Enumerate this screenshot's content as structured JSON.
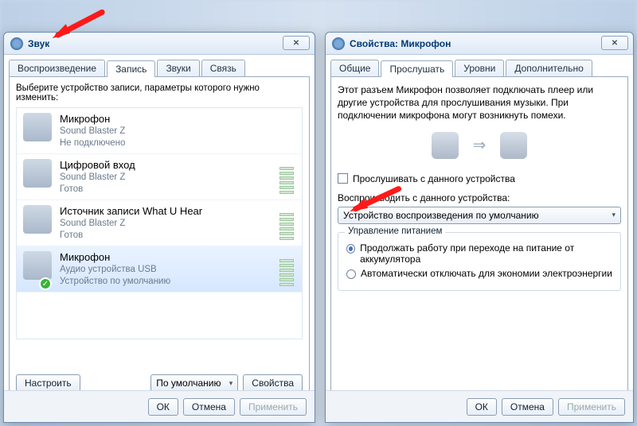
{
  "left": {
    "title": "Звук",
    "tabs": [
      "Воспроизведение",
      "Запись",
      "Звуки",
      "Связь"
    ],
    "active_tab": 1,
    "hint": "Выберите устройство записи, параметры которого нужно изменить:",
    "devices": [
      {
        "name": "Микрофон",
        "sub1": "Sound Blaster Z",
        "sub2": "Не подключено",
        "level": false
      },
      {
        "name": "Цифровой вход",
        "sub1": "Sound Blaster Z",
        "sub2": "Готов",
        "level": true
      },
      {
        "name": "Источник записи What U Hear",
        "sub1": "Sound Blaster Z",
        "sub2": "Готов",
        "level": true
      },
      {
        "name": "Микрофон",
        "sub1": "Аудио устройства USB",
        "sub2": "Устройство по умолчанию",
        "level": true,
        "selected": true,
        "default": true
      }
    ],
    "configure": "Настроить",
    "default_btn": "По умолчанию",
    "properties": "Свойства",
    "ok": "ОК",
    "cancel": "Отмена",
    "apply": "Применить"
  },
  "right": {
    "title": "Свойства: Микрофон",
    "tabs": [
      "Общие",
      "Прослушать",
      "Уровни",
      "Дополнительно"
    ],
    "active_tab": 1,
    "desc": "Этот разъем Микрофон позволяет подключать плеер или другие устройства для прослушивания музыки. При подключении микрофона могут возникнуть помехи.",
    "listen_chk": "Прослушивать с данного устройства",
    "playback_lbl": "Воспроизводить с данного устройства:",
    "playback_val": "Устройство воспроизведения по умолчанию",
    "power_group": "Управление питанием",
    "radio1": "Продолжать работу при переходе на питание от аккумулятора",
    "radio2": "Автоматически отключать для экономии электроэнергии",
    "ok": "ОК",
    "cancel": "Отмена",
    "apply": "Применить"
  }
}
